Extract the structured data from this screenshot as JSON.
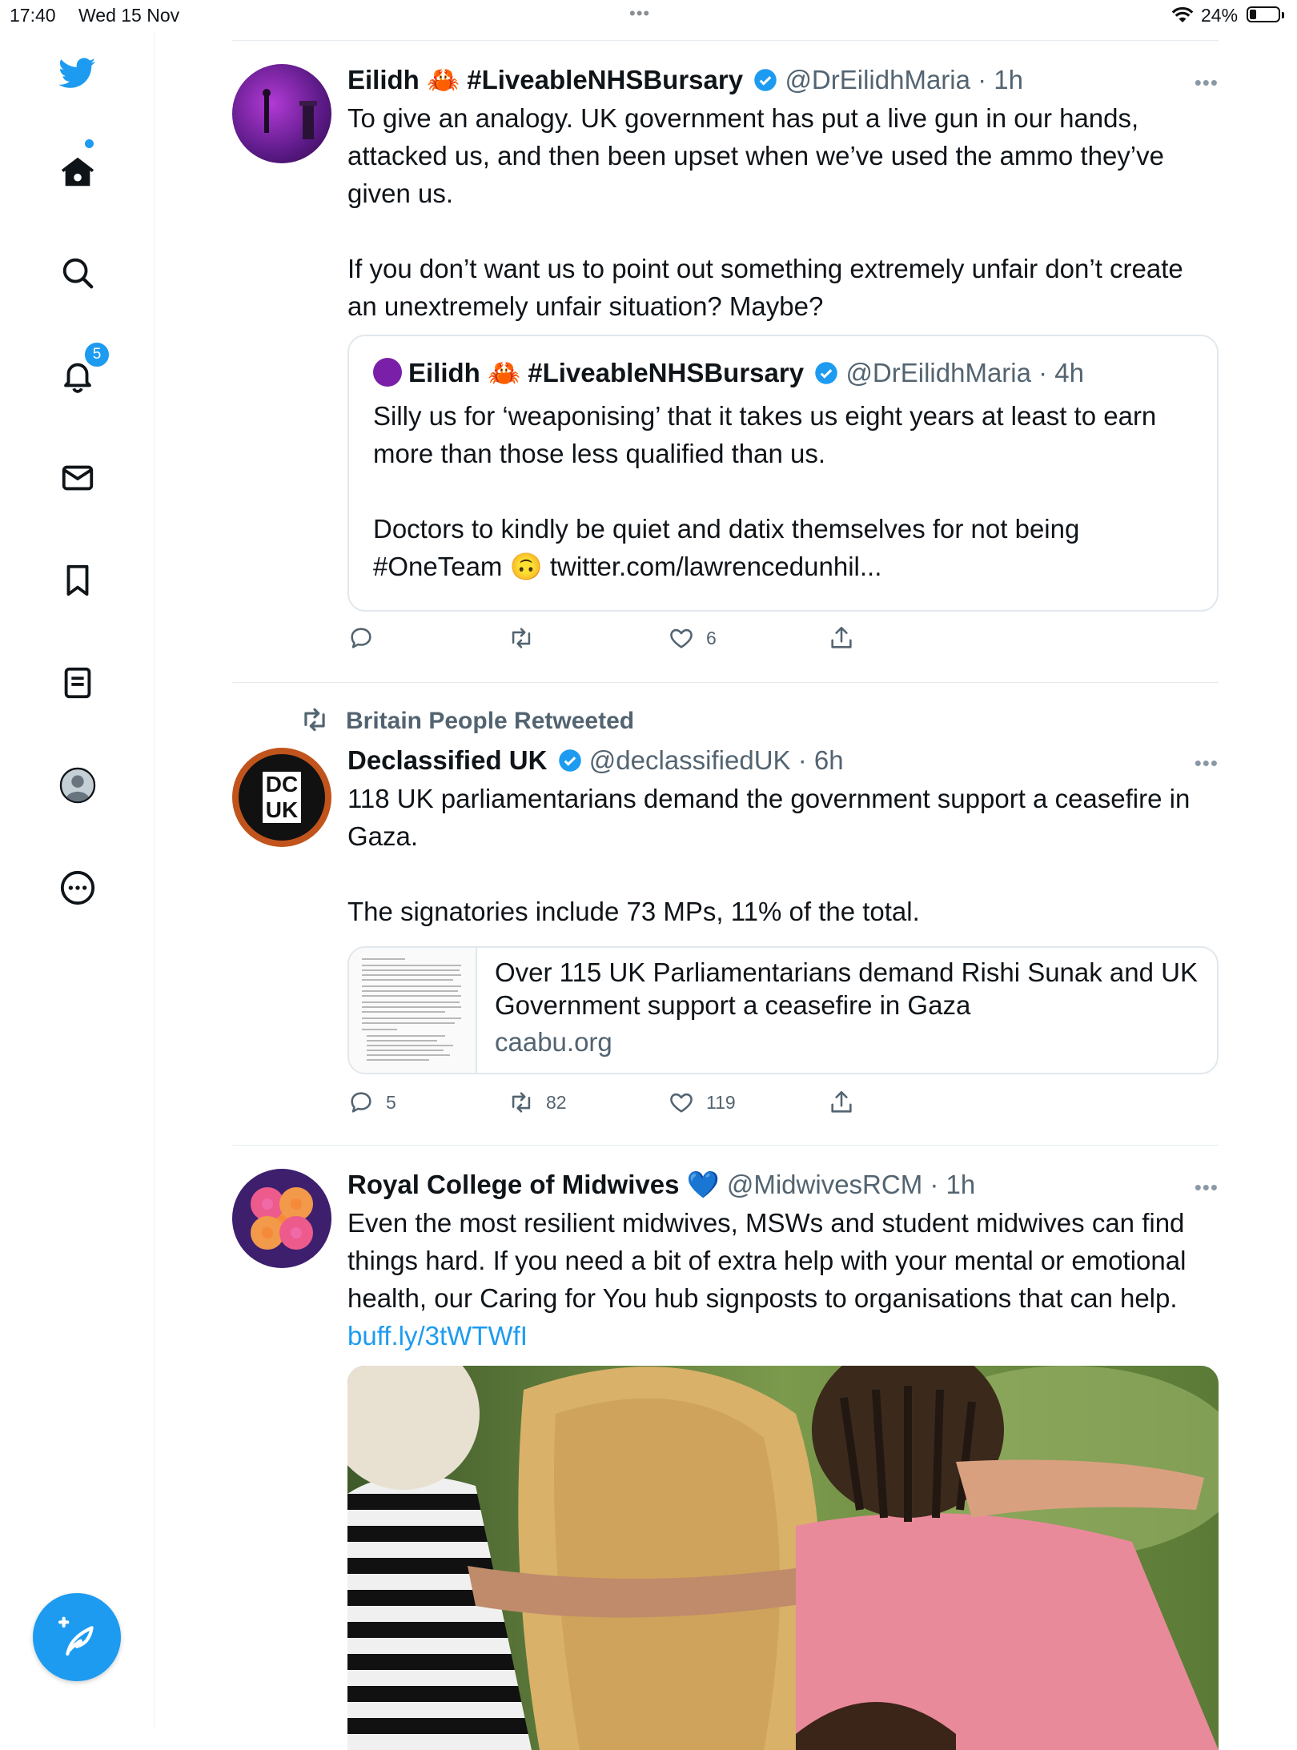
{
  "status_bar": {
    "time": "17:40",
    "date": "Wed 15 Nov",
    "dots": "•••",
    "battery": "24%"
  },
  "sidebar": {
    "notification_count": "5"
  },
  "tweets": [
    {
      "name": "Eilidh 🦀 #LiveableNHSBursary",
      "handle": "@DrEilidhMaria · 1h",
      "text": "To give an analogy. UK government has put a live gun in our hands, attacked us, and then been upset when we’ve used the ammo they’ve given us.\n\nIf you don’t want us to point out something extremely unfair don’t create an unextremely unfair situation? Maybe?",
      "quote": {
        "name": "Eilidh 🦀 #LiveableNHSBursary",
        "handle": "@DrEilidhMaria · 4h",
        "text": "Silly us for ‘weaponising’ that it takes us eight years at least to earn more than those less qualified than us.\n\nDoctors to kindly be quiet and datix themselves for not being #OneTeam 🙃 twitter.com/lawrencedunhil..."
      },
      "likes": "6"
    },
    {
      "retweeted_by": "Britain People Retweeted",
      "name": "Declassified UK",
      "handle": "@declassifiedUK · 6h",
      "avatar_text_top": "DC",
      "avatar_text_bottom": "UK",
      "text": "118 UK parliamentarians demand the government support a ceasefire in Gaza.\n\nThe signatories include 73 MPs, 11% of the total.",
      "card": {
        "title": "Over 115 UK Parliamentarians demand Rishi Sunak and UK Government support a ceasefire in Gaza",
        "domain": "caabu.org"
      },
      "replies": "5",
      "retweets": "82",
      "likes": "119"
    },
    {
      "name": "Royal College of Midwives",
      "emoji": "💙",
      "handle": "@MidwivesRCM · 1h",
      "text": "Even the most resilient midwives, MSWs and student midwives can find things hard. If you need a bit of extra help with your mental or emotional health, our Caring for You hub signposts to organisations that can help.",
      "link": "buff.ly/3tWTWfI"
    }
  ]
}
